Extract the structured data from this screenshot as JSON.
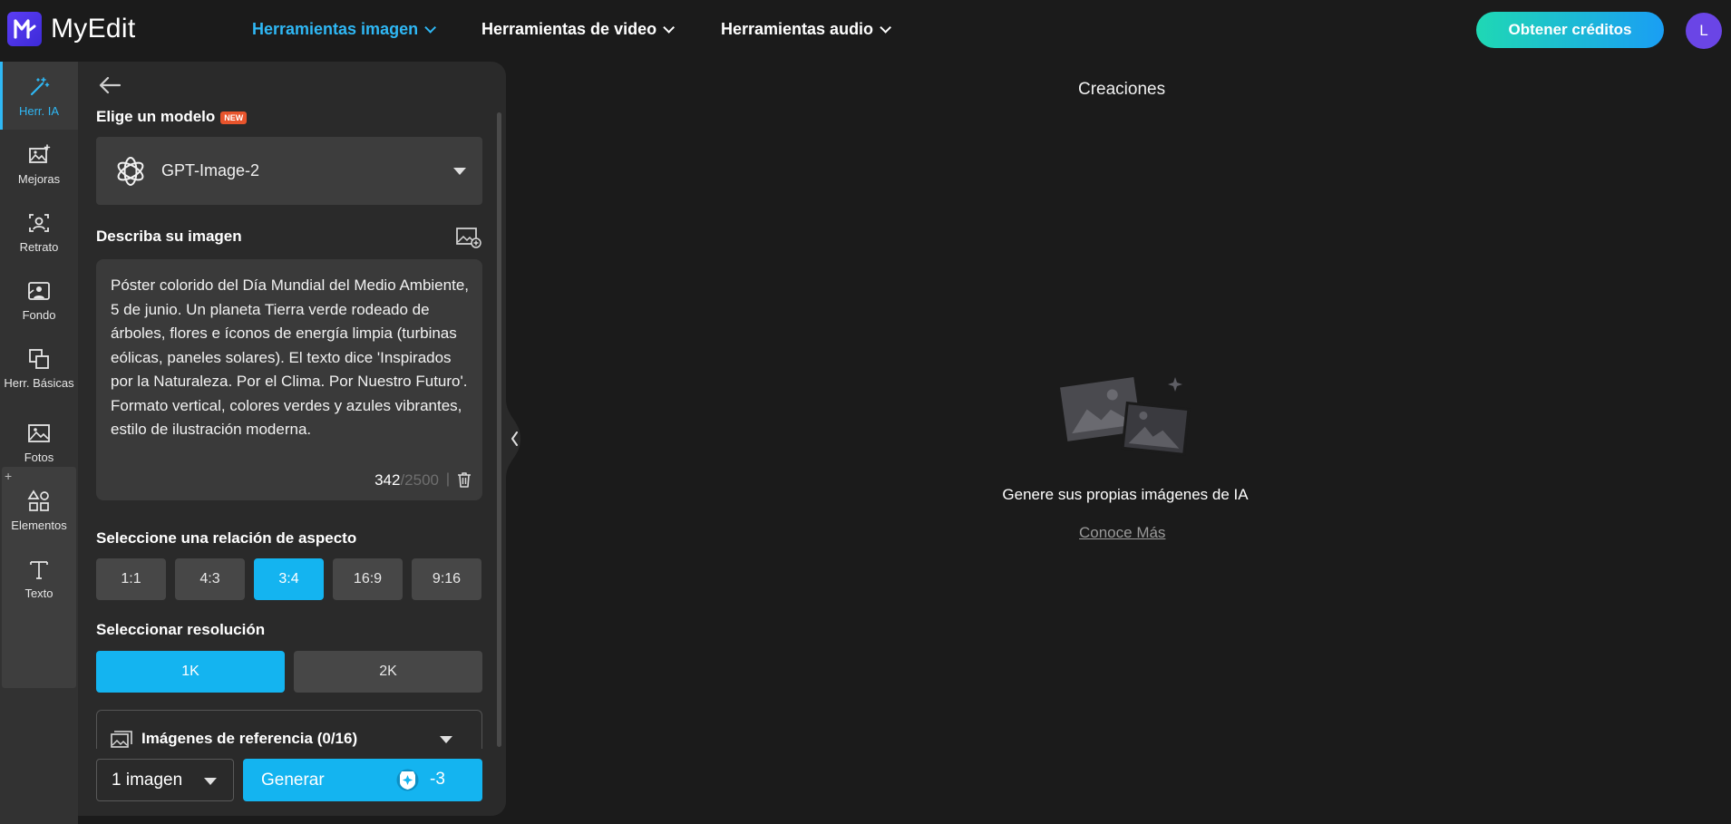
{
  "app": {
    "name": "MyEdit"
  },
  "nav": [
    {
      "label": "Herramientas imagen",
      "active": true
    },
    {
      "label": "Herramientas de video",
      "active": false
    },
    {
      "label": "Herramientas audio",
      "active": false
    }
  ],
  "header": {
    "credits_label": "Obtener créditos",
    "avatar_initial": "L"
  },
  "rail": [
    {
      "label": "Herr. IA",
      "icon": "magic-wand-icon",
      "active": true
    },
    {
      "label": "Mejoras",
      "icon": "image-enhance-icon"
    },
    {
      "label": "Retrato",
      "icon": "portrait-icon"
    },
    {
      "label": "Fondo",
      "icon": "background-icon"
    },
    {
      "label": "Herr. Básicas",
      "icon": "basic-tools-icon"
    },
    {
      "label": "Fotos",
      "icon": "photos-icon"
    },
    {
      "label": "Elementos",
      "icon": "elements-icon"
    },
    {
      "label": "Texto",
      "icon": "text-icon"
    }
  ],
  "rail_group_plus": "+",
  "panel": {
    "model_title": "Elige un modelo",
    "new_badge": "NEW",
    "model_value": "GPT-Image-2",
    "describe_title": "Describa su imagen",
    "prompt": "Póster colorido del Día Mundial del Medio Ambiente, 5 de junio. Un planeta Tierra verde rodeado de árboles, flores e íconos de energía limpia (turbinas eólicas, paneles solares). El texto dice 'Inspirados por la Naturaleza. Por el Clima. Por Nuestro Futuro'. Formato vertical, colores verdes y azules vibrantes, estilo de ilustración moderna.",
    "char_count": "342",
    "char_max": "/2500",
    "counter_sep": "|",
    "ratio_title": "Seleccione una relación de aspecto",
    "ratios": [
      {
        "label": "1:1",
        "active": false
      },
      {
        "label": "4:3",
        "active": false
      },
      {
        "label": "3:4",
        "active": true
      },
      {
        "label": "16:9",
        "active": false
      },
      {
        "label": "9:16",
        "active": false
      }
    ],
    "resolution_title": "Seleccionar resolución",
    "resolutions": [
      {
        "label": "1K",
        "active": true
      },
      {
        "label": "2K",
        "active": false
      }
    ],
    "reference_label": "Imágenes de referencia (0/16)",
    "quantity_value": "1 imagen",
    "generate_label": "Generar",
    "generate_cost": "-3"
  },
  "main": {
    "title": "Creaciones",
    "empty_text": "Genere sus propias imágenes de IA",
    "learn_more": "Conoce Más"
  },
  "colors": {
    "accent": "#14b4f0",
    "nav_active": "#2fb8f5",
    "badge": "#e8542c",
    "avatar": "#6a45e6"
  }
}
